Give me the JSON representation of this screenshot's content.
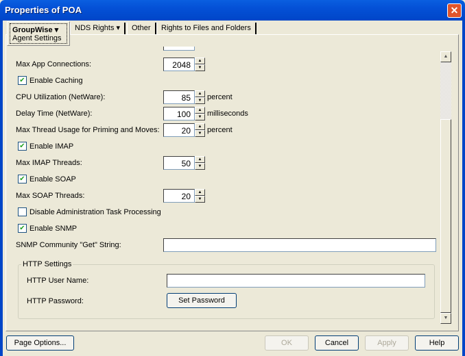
{
  "window": {
    "title": "Properties of POA",
    "close": "✕"
  },
  "tabs": [
    {
      "label": "GroupWise ▾",
      "sub": "Agent Settings"
    },
    {
      "label": "NDS Rights ▾"
    },
    {
      "label": "Other"
    },
    {
      "label": "Rights to Files and Folders"
    }
  ],
  "fields": {
    "max_app_connections": {
      "label": "Max App Connections:",
      "value": "2048"
    },
    "enable_caching": {
      "label": "Enable Caching",
      "checked": true
    },
    "cpu": {
      "label": "CPU Utilization (NetWare):",
      "value": "85",
      "unit": "percent"
    },
    "delay": {
      "label": "Delay Time (NetWare):",
      "value": "100",
      "unit": "milliseconds"
    },
    "thread": {
      "label": "Max Thread Usage for Priming and Moves:",
      "value": "20",
      "unit": "percent"
    },
    "enable_imap": {
      "label": "Enable IMAP",
      "checked": true
    },
    "imap_threads": {
      "label": "Max IMAP Threads:",
      "value": "50"
    },
    "enable_soap": {
      "label": "Enable SOAP",
      "checked": true
    },
    "soap_threads": {
      "label": "Max SOAP Threads:",
      "value": "20"
    },
    "disable_admin": {
      "label": "Disable Administration Task Processing",
      "checked": false
    },
    "enable_snmp": {
      "label": "Enable SNMP",
      "checked": true
    },
    "snmp_string": {
      "label": "SNMP Community \"Get\" String:",
      "value": ""
    }
  },
  "http": {
    "title": "HTTP Settings",
    "user_label": "HTTP User Name:",
    "user_value": "",
    "password_label": "HTTP Password:",
    "set_password": "Set Password"
  },
  "buttons": {
    "page_options": "Page Options...",
    "ok": "OK",
    "cancel": "Cancel",
    "apply": "Apply",
    "help": "Help"
  },
  "check_glyph": "✔"
}
